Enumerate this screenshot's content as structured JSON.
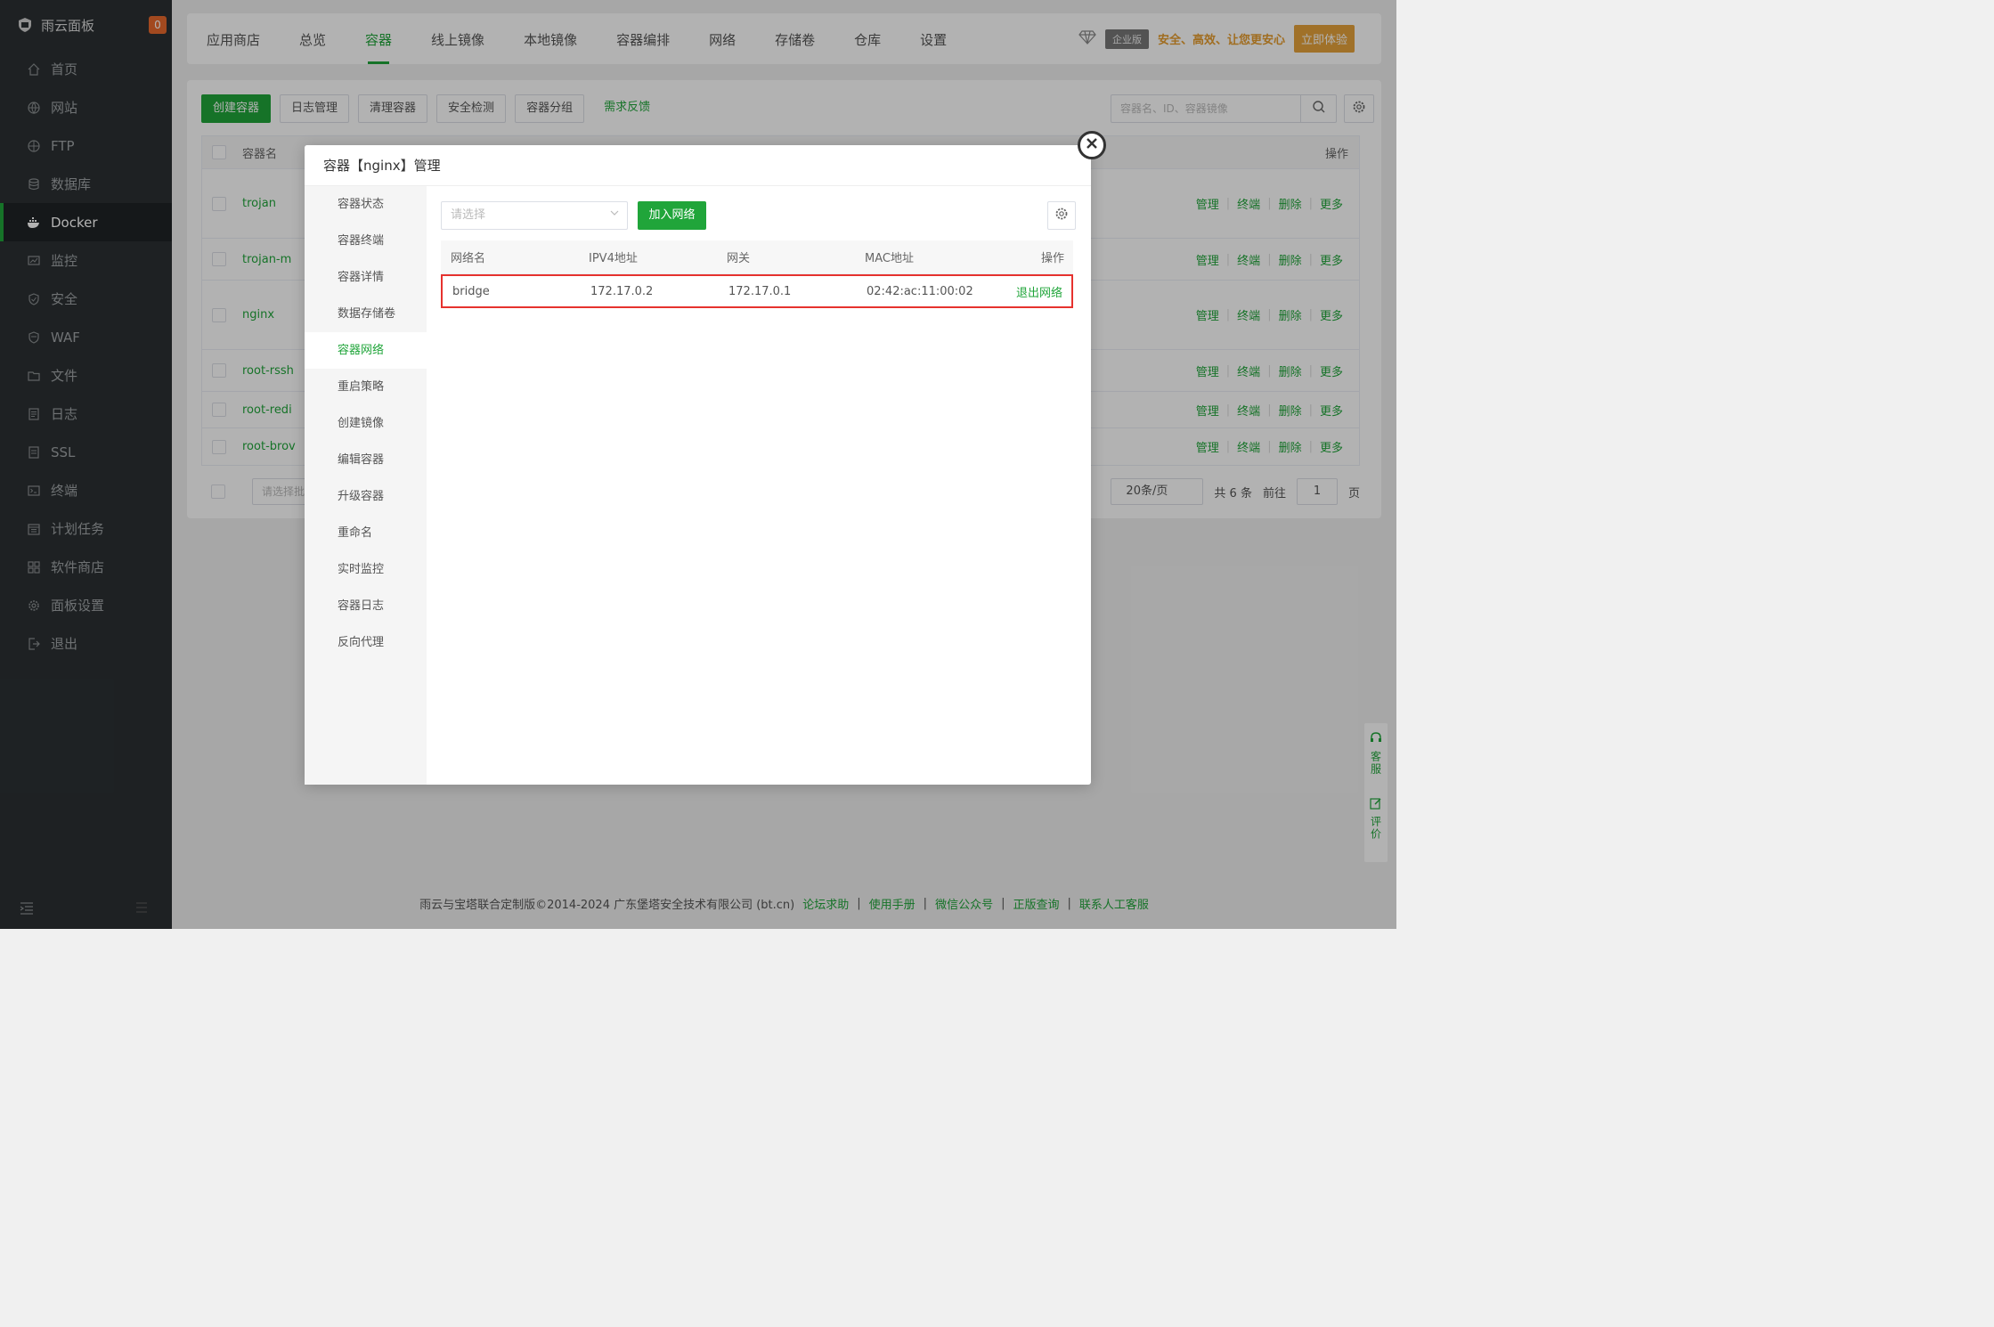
{
  "sidebar": {
    "brand": "雨云面板",
    "badge": "0",
    "items": [
      {
        "label": "首页",
        "icon": "home-icon"
      },
      {
        "label": "网站",
        "icon": "globe-icon"
      },
      {
        "label": "FTP",
        "icon": "ftp-icon"
      },
      {
        "label": "数据库",
        "icon": "database-icon"
      },
      {
        "label": "Docker",
        "icon": "docker-icon"
      },
      {
        "label": "监控",
        "icon": "monitor-icon"
      },
      {
        "label": "安全",
        "icon": "shield-icon"
      },
      {
        "label": "WAF",
        "icon": "waf-icon"
      },
      {
        "label": "文件",
        "icon": "folder-icon"
      },
      {
        "label": "日志",
        "icon": "log-icon"
      },
      {
        "label": "SSL",
        "icon": "ssl-icon"
      },
      {
        "label": "终端",
        "icon": "terminal-icon"
      },
      {
        "label": "计划任务",
        "icon": "calendar-icon"
      },
      {
        "label": "软件商店",
        "icon": "apps-icon"
      },
      {
        "label": "面板设置",
        "icon": "gear-icon"
      },
      {
        "label": "退出",
        "icon": "logout-icon"
      }
    ]
  },
  "tabs": [
    "应用商店",
    "总览",
    "容器",
    "线上镜像",
    "本地镜像",
    "容器编排",
    "网络",
    "存储卷",
    "仓库",
    "设置"
  ],
  "enterprise": {
    "tag": "企业版",
    "slogan": "安全、高效、让您更安心",
    "try": "立即体验"
  },
  "toolbar": {
    "create": "创建容器",
    "log": "日志管理",
    "clean": "清理容器",
    "security": "安全检测",
    "group": "容器分组",
    "feedback": "需求反馈",
    "search_placeholder": "容器名、ID、容器镜像"
  },
  "table": {
    "header_name": "容器名",
    "header_ops": "操作",
    "rows": [
      "trojan",
      "trojan-m",
      "nginx",
      "root-rssh",
      "root-redi",
      "root-brov"
    ],
    "ops": {
      "manage": "管理",
      "terminal": "终端",
      "delete": "删除",
      "more": "更多"
    }
  },
  "pager": {
    "batch_placeholder": "请选择批量",
    "per_page": "20条/页",
    "total": "共 6 条",
    "goto": "前往",
    "page": "1",
    "page_suffix": "页"
  },
  "footer": {
    "copyright": "雨云与宝塔联合定制版©2014-2024 广东堡塔安全技术有限公司 (bt.cn)",
    "links": [
      "论坛求助",
      "使用手册",
      "微信公众号",
      "正版查询",
      "联系人工客服"
    ]
  },
  "float": {
    "service": "客服",
    "review": "评价"
  },
  "modal": {
    "title": "容器【nginx】管理",
    "menu": [
      "容器状态",
      "容器终端",
      "容器详情",
      "数据存储卷",
      "容器网络",
      "重启策略",
      "创建镜像",
      "编辑容器",
      "升级容器",
      "重命名",
      "实时监控",
      "容器日志",
      "反向代理"
    ],
    "select_placeholder": "请选择",
    "join": "加入网络",
    "net_headers": {
      "name": "网络名",
      "ipv4": "IPV4地址",
      "gateway": "网关",
      "mac": "MAC地址",
      "ops": "操作"
    },
    "network": {
      "name": "bridge",
      "ipv4": "172.17.0.2",
      "gateway": "172.17.0.1",
      "mac": "02:42:ac:11:00:02",
      "action": "退出网络"
    }
  },
  "colors": {
    "accent": "#20a53a",
    "sidebar": "#2b3033",
    "highlight": "#e6322e",
    "badge": "#e8692d"
  }
}
